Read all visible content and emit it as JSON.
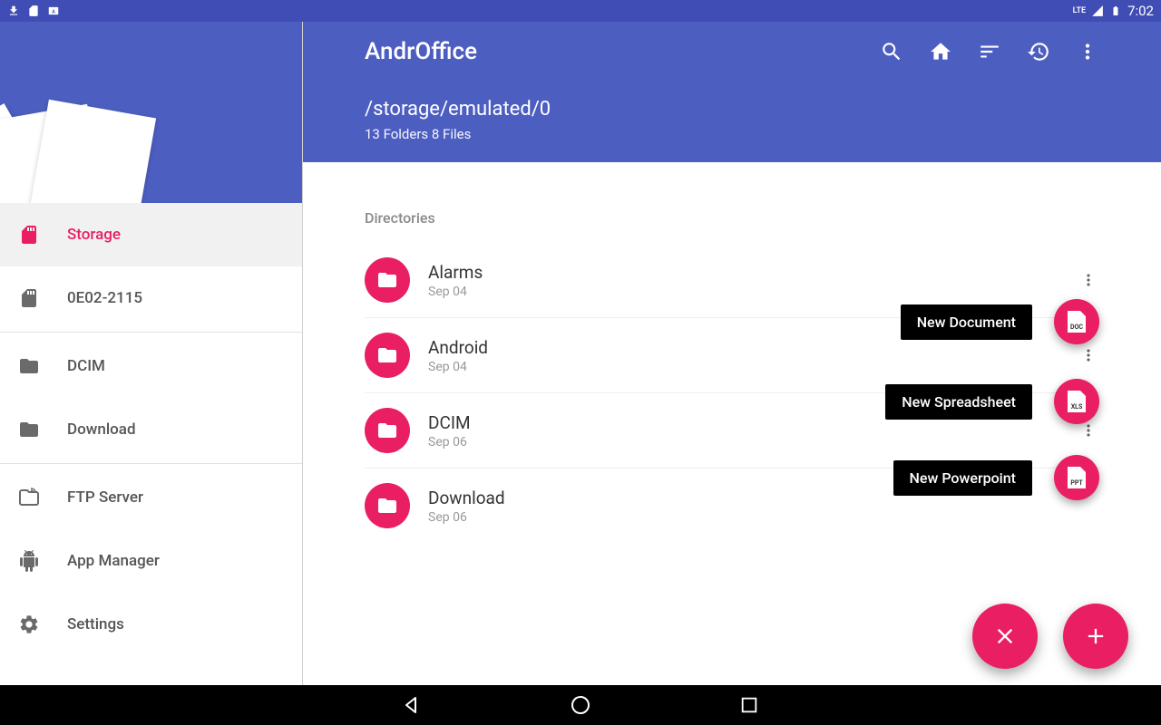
{
  "status_bar": {
    "time": "7:02",
    "lte": "LTE"
  },
  "sidebar": {
    "items": [
      {
        "label": "Storage",
        "icon": "sd-card",
        "active": true
      },
      {
        "label": "0E02-2115",
        "icon": "sd-card",
        "active": false
      },
      {
        "label": "DCIM",
        "icon": "folder",
        "active": false
      },
      {
        "label": "Download",
        "icon": "folder",
        "active": false
      },
      {
        "label": "FTP Server",
        "icon": "ftp",
        "active": false
      },
      {
        "label": "App Manager",
        "icon": "android",
        "active": false
      },
      {
        "label": "Settings",
        "icon": "gear",
        "active": false
      }
    ]
  },
  "header": {
    "title": "AndrOffice",
    "path": "/storage/emulated/0",
    "summary": "13 Folders 8 Files"
  },
  "content": {
    "section_label": "Directories",
    "directories": [
      {
        "name": "Alarms",
        "date": "Sep 04"
      },
      {
        "name": "Android",
        "date": "Sep 04"
      },
      {
        "name": "DCIM",
        "date": "Sep 06"
      },
      {
        "name": "Download",
        "date": "Sep 06"
      }
    ]
  },
  "fab_actions": [
    {
      "label": "New Document",
      "badge": "DOC"
    },
    {
      "label": "New Spreadsheet",
      "badge": "XLS"
    },
    {
      "label": "New Powerpoint",
      "badge": "PPT"
    }
  ],
  "colors": {
    "primary": "#4d5ec1",
    "accent": "#e91e63"
  }
}
